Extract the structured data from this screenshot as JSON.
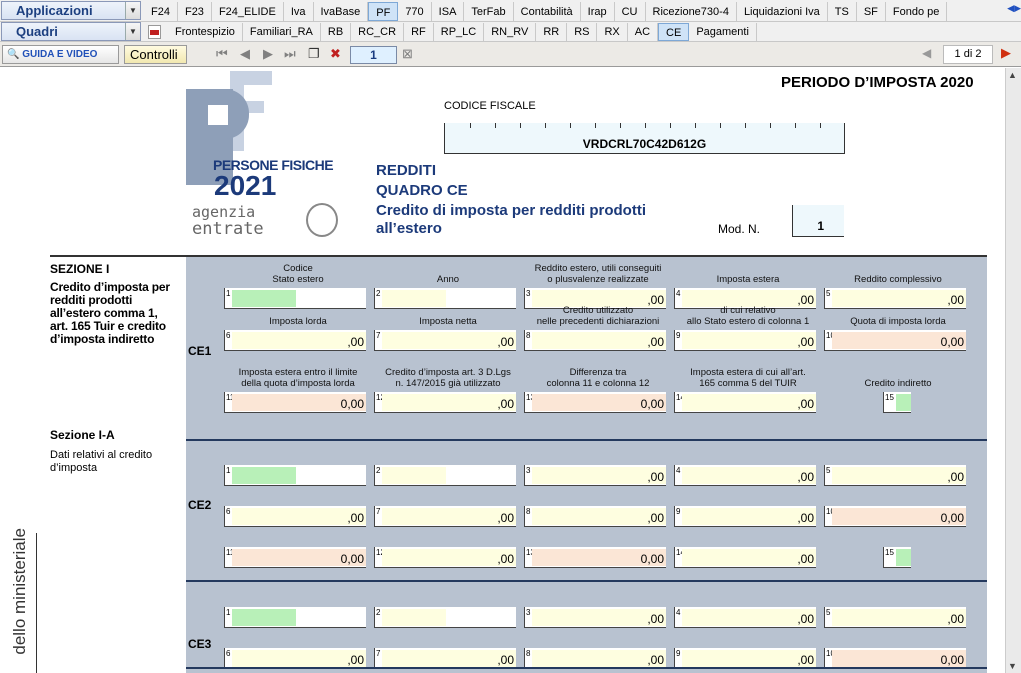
{
  "toolbar": {
    "applicazioni": "Applicazioni",
    "quadri": "Quadri",
    "row1_tabs": [
      "F24",
      "F23",
      "F24_ELIDE",
      "Iva",
      "IvaBase",
      "PF",
      "770",
      "ISA",
      "TerFab",
      "Contabilità",
      "Irap",
      "CU",
      "Ricezione730-4",
      "Liquidazioni Iva",
      "TS",
      "SF",
      "Fondo pe"
    ],
    "row1_active": "PF",
    "row2_tabs": [
      "Frontespizio",
      "Familiari_RA",
      "RB",
      "RC_CR",
      "RF",
      "RP_LC",
      "RN_RV",
      "RR",
      "RS",
      "RX",
      "AC",
      "CE",
      "Pagamenti"
    ],
    "row2_active": "CE",
    "guida": "GUIDA E VIDEO",
    "controlli": "Controlli",
    "page": "1",
    "page_count": "1 di 2"
  },
  "doc": {
    "periodo": "PERIODO D’IMPOSTA 2020",
    "cf_label": "CODICE FISCALE",
    "cf_value": "VRDCRL70C42D612G",
    "redditi": "REDDITI",
    "quadro": "QUADRO CE",
    "credito": "Credito di imposta per redditi prodotti all’estero",
    "modn_label": "Mod. N.",
    "modn_value": "1",
    "logo_persone": "PERSONE FISICHE",
    "logo_year": "2021",
    "logo_agenzia": "genzia",
    "logo_entrate": "ntrate",
    "sez1": "SEZIONE I",
    "sez1_desc": "Credito d’imposta per redditi prodotti all’estero comma 1, art. 165 Tuir e credito d’imposta indiretto",
    "sez1a": "Sezione I-A",
    "sez1a_desc": "Dati relativi al credito d’imposta",
    "vertical": "dello ministeriale"
  },
  "headers_row1": [
    "Codice\nStato estero",
    "Anno",
    "Reddito estero, utili conseguiti\no plusvalenze realizzate",
    "Imposta estera",
    "Reddito complessivo"
  ],
  "headers_row2": [
    "Imposta lorda",
    "Imposta netta",
    "Credito utilizzato\nnelle precedenti dichiarazioni",
    "di cui relativo\nallo Stato estero di colonna 1",
    "Quota di imposta lorda"
  ],
  "headers_row3": [
    "Imposta estera entro il limite\ndella quota d’imposta lorda",
    "Credito d’imposta art. 3 D.Lgs\nn. 147/2015 già utilizzato",
    "Differenza tra\ncolonna 11 e colonna 12",
    "Imposta estera di cui all’art.\n165 comma 5 del TUIR",
    "Credito indiretto"
  ],
  "sections": [
    {
      "label": "CE1",
      "rows": [
        [
          {
            "n": "1",
            "f": "g",
            "w": "s",
            "v": ""
          },
          {
            "n": "2",
            "f": "y",
            "w": "s",
            "v": ""
          },
          {
            "n": "3",
            "f": "y",
            "v": ",00"
          },
          {
            "n": "4",
            "f": "y",
            "v": ",00"
          },
          {
            "n": "5",
            "f": "y",
            "v": ",00"
          }
        ],
        [
          {
            "n": "6",
            "f": "y",
            "v": ",00"
          },
          {
            "n": "7",
            "f": "y",
            "v": ",00"
          },
          {
            "n": "8",
            "f": "y",
            "v": ",00"
          },
          {
            "n": "9",
            "f": "y",
            "v": ",00"
          },
          {
            "n": "10",
            "f": "o",
            "v": "0,00"
          }
        ],
        [
          {
            "n": "11",
            "f": "o",
            "v": "0,00"
          },
          {
            "n": "12",
            "f": "y",
            "v": ",00"
          },
          {
            "n": "13",
            "f": "o",
            "v": "0,00"
          },
          {
            "n": "14",
            "f": "y",
            "v": ",00"
          },
          {
            "n": "15",
            "f": "g",
            "w": "xs",
            "v": ""
          }
        ]
      ]
    },
    {
      "label": "CE2",
      "rows": [
        [
          {
            "n": "1",
            "f": "g",
            "w": "s",
            "v": ""
          },
          {
            "n": "2",
            "f": "y",
            "w": "s",
            "v": ""
          },
          {
            "n": "3",
            "f": "y",
            "v": ",00"
          },
          {
            "n": "4",
            "f": "y",
            "v": ",00"
          },
          {
            "n": "5",
            "f": "y",
            "v": ",00"
          }
        ],
        [
          {
            "n": "6",
            "f": "y",
            "v": ",00"
          },
          {
            "n": "7",
            "f": "y",
            "v": ",00"
          },
          {
            "n": "8",
            "f": "y",
            "v": ",00"
          },
          {
            "n": "9",
            "f": "y",
            "v": ",00"
          },
          {
            "n": "10",
            "f": "o",
            "v": "0,00"
          }
        ],
        [
          {
            "n": "11",
            "f": "o",
            "v": "0,00"
          },
          {
            "n": "12",
            "f": "y",
            "v": ",00"
          },
          {
            "n": "13",
            "f": "o",
            "v": "0,00"
          },
          {
            "n": "14",
            "f": "y",
            "v": ",00"
          },
          {
            "n": "15",
            "f": "g",
            "w": "xs",
            "v": ""
          }
        ]
      ]
    },
    {
      "label": "CE3",
      "rows": [
        [
          {
            "n": "1",
            "f": "g",
            "w": "s",
            "v": ""
          },
          {
            "n": "2",
            "f": "y",
            "w": "s",
            "v": ""
          },
          {
            "n": "3",
            "f": "y",
            "v": ",00"
          },
          {
            "n": "4",
            "f": "y",
            "v": ",00"
          },
          {
            "n": "5",
            "f": "y",
            "v": ",00"
          }
        ],
        [
          {
            "n": "6",
            "f": "y",
            "v": ",00"
          },
          {
            "n": "7",
            "f": "y",
            "v": ",00"
          },
          {
            "n": "8",
            "f": "y",
            "v": ",00"
          },
          {
            "n": "9",
            "f": "y",
            "v": ",00"
          },
          {
            "n": "10",
            "f": "o",
            "v": "0,00"
          }
        ]
      ]
    }
  ]
}
